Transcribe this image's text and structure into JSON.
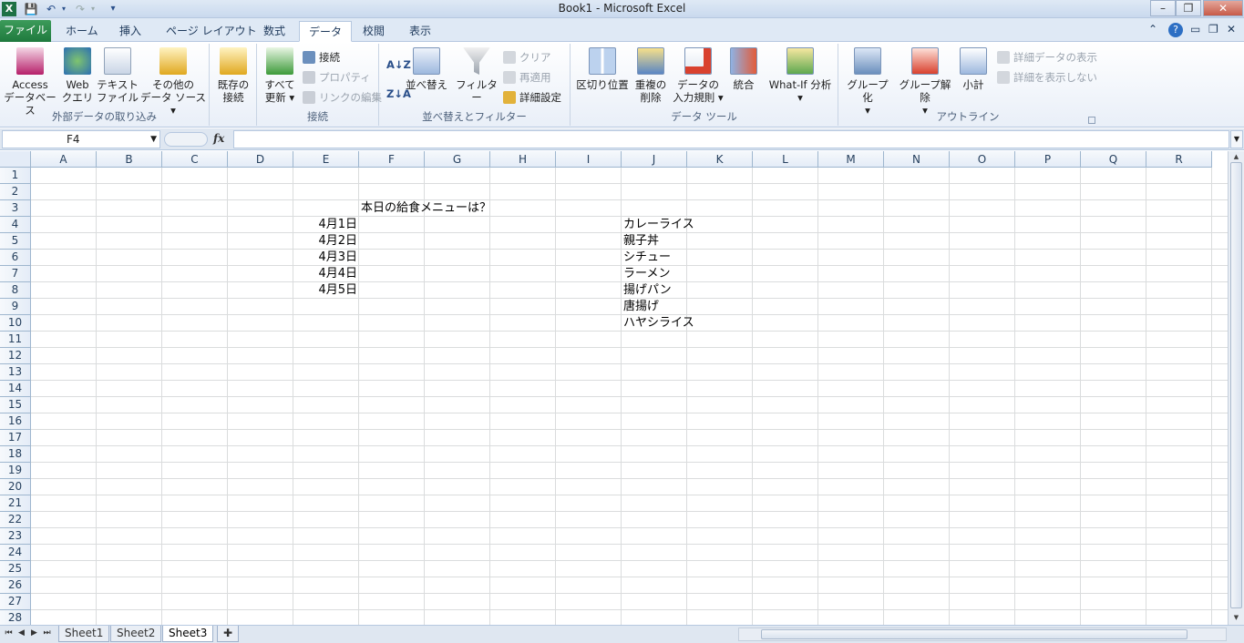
{
  "window": {
    "title": "Book1 - Microsoft Excel"
  },
  "qat": {
    "save_icon": "save-icon",
    "undo_icon": "undo-icon",
    "redo_icon": "redo-icon",
    "customize_icon": "customize-qat-icon"
  },
  "tabs": [
    {
      "label": "ファイル"
    },
    {
      "label": "ホーム"
    },
    {
      "label": "挿入"
    },
    {
      "label": "ページ レイアウト"
    },
    {
      "label": "数式"
    },
    {
      "label": "データ"
    },
    {
      "label": "校閲"
    },
    {
      "label": "表示"
    }
  ],
  "ribbon": {
    "external": {
      "label": "外部データの取り込み",
      "access": "Access\nデータベース",
      "web": "Web\nクエリ",
      "text": "テキスト\nファイル",
      "other": "その他の\nデータ ソース ▾",
      "existing": "既存の\n接続"
    },
    "connections": {
      "label": "接続",
      "refresh": "すべて\n更新 ▾",
      "connect": "接続",
      "properties": "プロパティ",
      "edit_links": "リンクの編集"
    },
    "sort": {
      "label": "並べ替えとフィルター",
      "sort": "並べ替え",
      "filter": "フィルター",
      "clear": "クリア",
      "reapply": "再適用",
      "advanced": "詳細設定"
    },
    "tools": {
      "label": "データ ツール",
      "text_to_columns": "区切り位置",
      "remove_dup": "重複の\n削除",
      "validation": "データの\n入力規則 ▾",
      "consolidate": "統合",
      "whatif": "What-If 分析\n▾"
    },
    "outline": {
      "label": "アウトライン",
      "group": "グループ化\n▾",
      "ungroup": "グループ解除\n▾",
      "subtotal": "小計",
      "show_detail": "詳細データの表示",
      "hide_detail": "詳細を表示しない"
    }
  },
  "formula_bar": {
    "name_box": "F4",
    "fx": "fx",
    "value": ""
  },
  "columns": [
    "A",
    "B",
    "C",
    "D",
    "E",
    "F",
    "G",
    "H",
    "I",
    "J",
    "K",
    "L",
    "M",
    "N",
    "O",
    "P",
    "Q",
    "R"
  ],
  "rows": [
    "1",
    "2",
    "3",
    "4",
    "5",
    "6",
    "7",
    "8",
    "9",
    "10",
    "11",
    "12",
    "13",
    "14",
    "15",
    "16",
    "17",
    "18",
    "19",
    "20",
    "21",
    "22",
    "23",
    "24",
    "25",
    "26",
    "27",
    "28"
  ],
  "cells": {
    "F3": "本日の給食メニューは？",
    "E4": "4月1日",
    "E5": "4月2日",
    "E6": "4月3日",
    "E7": "4月4日",
    "E8": "4月5日",
    "J4": "カレーライス",
    "J5": "親子丼",
    "J6": "シチュー",
    "J7": "ラーメン",
    "J8": "揚げパン",
    "J9": "唐揚げ",
    "J10": "ハヤシライス"
  },
  "sheets": [
    {
      "name": "Sheet1"
    },
    {
      "name": "Sheet2"
    },
    {
      "name": "Sheet3",
      "active": true
    }
  ],
  "colors": {
    "accent": "#1f7a3e",
    "grid": "#dadcdd",
    "header": "#e4ecf7"
  }
}
